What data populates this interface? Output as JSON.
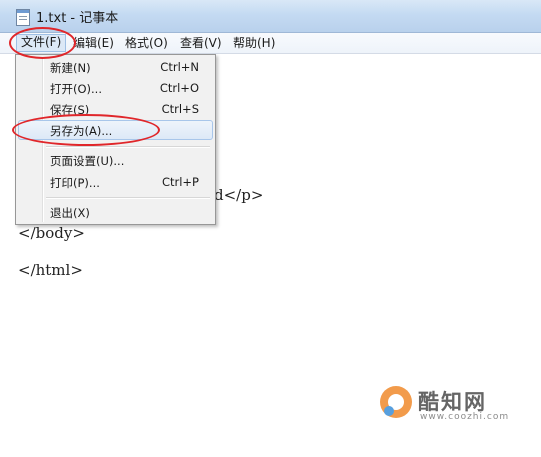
{
  "window": {
    "title": "1.txt - 记事本",
    "app_icon": "notepad-icon"
  },
  "menubar": {
    "items": [
      {
        "label": "文件(F)"
      },
      {
        "label": "编辑(E)"
      },
      {
        "label": "格式(O)"
      },
      {
        "label": "查看(V)"
      },
      {
        "label": "帮助(H)"
      }
    ],
    "active": "文件(F)"
  },
  "file_menu": {
    "items": [
      {
        "label": "新建(N)",
        "shortcut": "Ctrl+N"
      },
      {
        "label": "打开(O)...",
        "shortcut": "Ctrl+O"
      },
      {
        "label": "保存(S)",
        "shortcut": "Ctrl+S"
      },
      {
        "label": "另存为(A)...",
        "shortcut": ""
      },
      {
        "label": "页面设置(U)...",
        "shortcut": ""
      },
      {
        "label": "打印(P)...",
        "shortcut": "Ctrl+P"
      },
      {
        "label": "退出(X)",
        "shortcut": ""
      }
    ],
    "highlighted": "另存为(A)..."
  },
  "editor": {
    "lines": [
      "d</p>",
      "</body>",
      "</html>"
    ]
  },
  "annotations": {
    "color": "#e0262a"
  },
  "watermark": {
    "text": "酷知网",
    "url": "www.coozhi.com"
  },
  "colors": {
    "titlebar": "#c4daf2",
    "menu_bg": "#f1f1f1",
    "highlight_border": "#a8c6ea"
  }
}
